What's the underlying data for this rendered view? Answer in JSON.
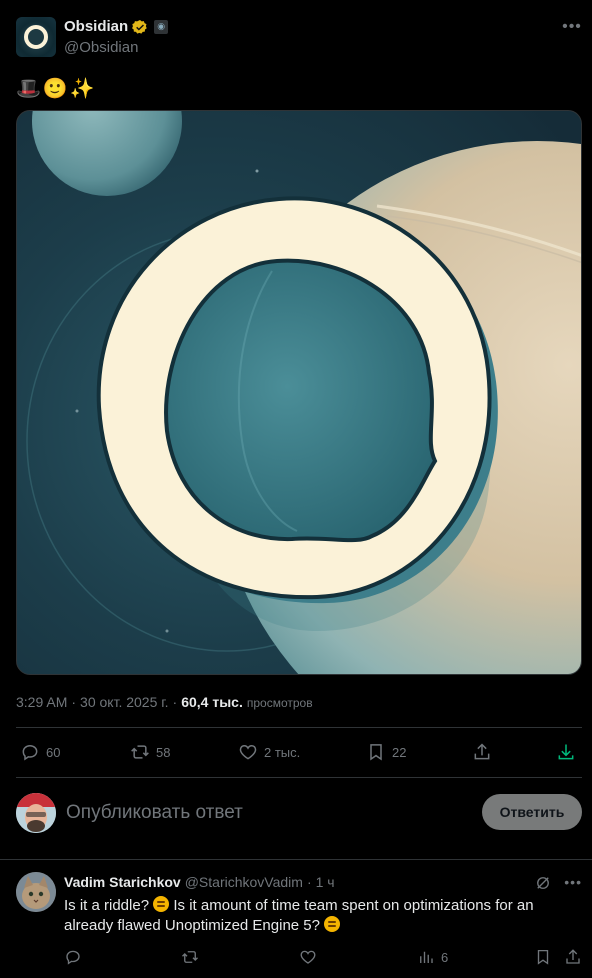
{
  "author": {
    "display_name": "Obsidian",
    "handle": "@Obsidian"
  },
  "tweet": {
    "text": "🎩🙂✨",
    "time": "3:29 AM",
    "date": "30 окт. 2025 г.",
    "views_count": "60,4 тыс.",
    "views_label": "просмотров",
    "replies": "60",
    "retweets": "58",
    "likes": "2 тыс.",
    "bookmarks": "22"
  },
  "composer": {
    "placeholder": "Опубликовать ответ",
    "button_label": "Ответить"
  },
  "reply": {
    "name": "Vadim Starichkov",
    "handle": "@StarichkovVadim",
    "time": "1 ч",
    "text_1": "Is it a riddle?",
    "text_2": "Is it amount of time team spent on optimizations for an already flawed Unoptimized Engine 5?",
    "views": "6"
  },
  "colors": {
    "background": "#000000",
    "text": "#e7e9ea",
    "muted": "#71767b",
    "verified_gold": "#e2b719",
    "download_green": "#00ba7c"
  }
}
